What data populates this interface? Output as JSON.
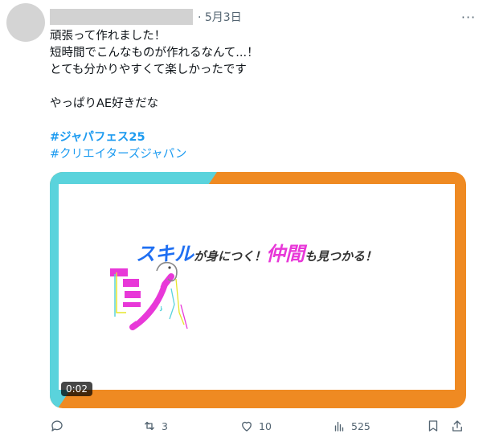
{
  "post": {
    "date": "· 5月3日",
    "more_label": "···",
    "text": "頑張って作れました！\n短時間でこんなものが作れるなんて...！\nとても分かりやすくて楽しかったです\n\nやっぱりAE好きだな",
    "hashtags": [
      "#ジャパフェス25",
      "#クリエイターズジャパン"
    ]
  },
  "media": {
    "headline_part1": "スキル",
    "headline_part2": "が身につく！",
    "headline_part3": "仲間",
    "headline_part4": "も見つかる！",
    "duration": "0:02",
    "colors": {
      "orange": "#ef8a22",
      "cyan": "#5ad3dc",
      "blue": "#1f6ff2",
      "magenta": "#e838d8"
    }
  },
  "actions": {
    "reply_count": "",
    "repost_count": "3",
    "like_count": "10",
    "views_count": "525"
  }
}
